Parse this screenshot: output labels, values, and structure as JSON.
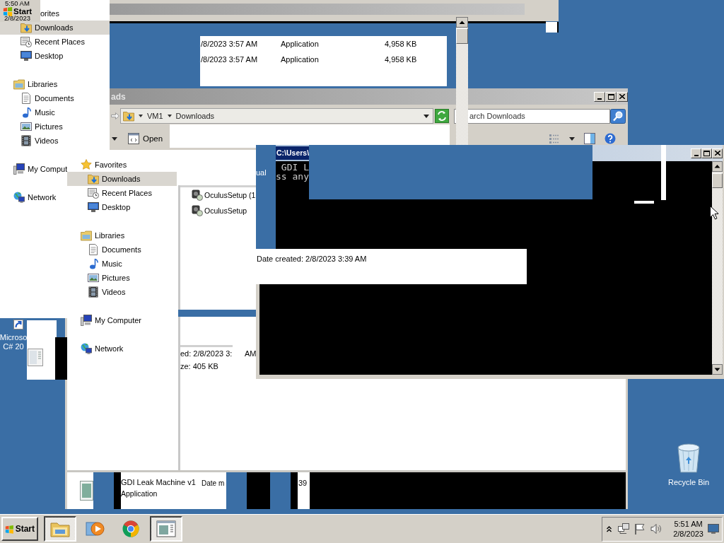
{
  "ghost_fragment": {
    "time": "5:50 AM",
    "start": "Start",
    "date": "2/8/2023"
  },
  "nav_fragment": [
    {
      "label": "orites",
      "selected": false,
      "children": [
        {
          "label": "Downloads",
          "selected": true
        },
        {
          "label": "Recent Places",
          "selected": false
        },
        {
          "label": "Desktop",
          "selected": false
        }
      ]
    },
    {
      "label": "Libraries",
      "selected": false,
      "children": [
        {
          "label": "Documents",
          "selected": false
        },
        {
          "label": "Music",
          "selected": false
        },
        {
          "label": "Pictures",
          "selected": false
        },
        {
          "label": "Videos",
          "selected": false
        }
      ]
    },
    {
      "label": "My Comput",
      "selected": false
    },
    {
      "label": "Network",
      "selected": false
    }
  ],
  "background_file_list": [
    {
      "date": "/8/2023 3:57 AM",
      "type": "Application",
      "size": "4,958 KB"
    },
    {
      "date": "/8/2023 3:57 AM",
      "type": "Application",
      "size": "4,958 KB"
    }
  ],
  "explorer": {
    "title": "ads",
    "breadcrumb": [
      "VM1",
      "Downloads"
    ],
    "search": {
      "placeholder": "arch Downloads"
    },
    "toolbar": {
      "open": "Open"
    },
    "nav": [
      {
        "label": "Favorites",
        "selected": false,
        "children": [
          {
            "label": "Downloads",
            "selected": true
          },
          {
            "label": "Recent Places",
            "selected": false
          },
          {
            "label": "Desktop",
            "selected": false
          }
        ]
      },
      {
        "label": "Libraries",
        "selected": false,
        "children": [
          {
            "label": "Documents",
            "selected": false
          },
          {
            "label": "Music",
            "selected": false
          },
          {
            "label": "Pictures",
            "selected": false
          },
          {
            "label": "Videos",
            "selected": false
          }
        ]
      },
      {
        "label": "My Computer",
        "selected": false
      },
      {
        "label": "Network",
        "selected": false
      }
    ],
    "files": [
      {
        "name": "OculusSetup (1",
        "selected": false
      },
      {
        "name": "OculusSetup",
        "selected": false
      }
    ],
    "details_fragment": {
      "created": "ed: 2/8/2023 3:",
      "created_suffix": "AM",
      "size": "ze: 405 KB"
    },
    "details_pane": {
      "name": "GDI Leak Machine v1",
      "type": "Application",
      "date_label": "Date m",
      "date_fragment": "39"
    }
  },
  "console": {
    "title": "C:\\Users\\",
    "lines": [
      " GDI L",
      "ss any"
    ],
    "side_text": "ual",
    "overlay_text": "Date created: 2/8/2023 3:39 AM"
  },
  "desktop_icons": [
    {
      "kind": "shortcut",
      "lines": [
        "Microso",
        "C# 20"
      ]
    },
    {
      "kind": "recycle_bin",
      "lines": [
        "Recycle Bin"
      ]
    }
  ],
  "taskbar": {
    "start": "Start",
    "apps": [
      {
        "selected": true
      },
      {
        "selected": false
      },
      {
        "selected": false
      },
      {
        "selected": true
      }
    ],
    "clock": {
      "time": "5:51 AM",
      "date": "2/8/2023"
    }
  }
}
